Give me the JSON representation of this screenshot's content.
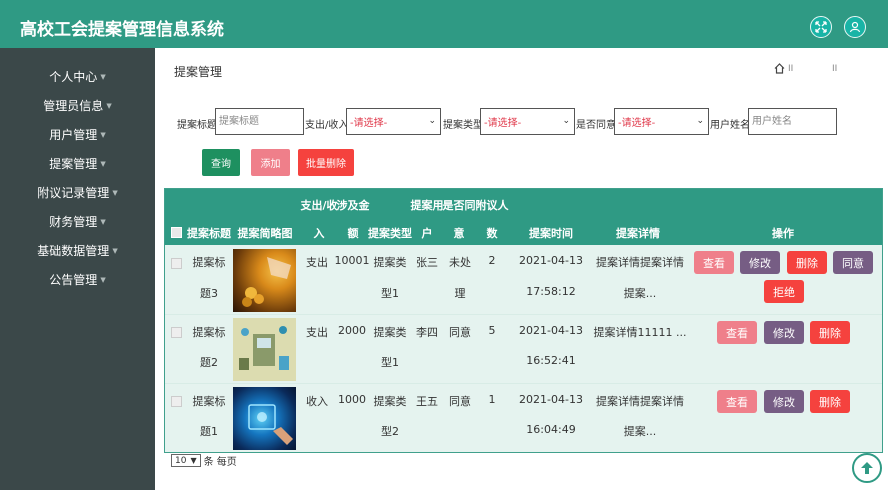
{
  "app": {
    "title": "高校工会提案管理信息系统"
  },
  "header_icons": [
    "fullscreen-icon",
    "user-icon"
  ],
  "sidebar": {
    "items": [
      {
        "label": "个人中心"
      },
      {
        "label": "管理员信息"
      },
      {
        "label": "用户管理"
      },
      {
        "label": "提案管理"
      },
      {
        "label": "附议记录管理"
      },
      {
        "label": "财务管理"
      },
      {
        "label": "基础数据管理"
      },
      {
        "label": "公告管理"
      }
    ]
  },
  "page": {
    "title": "提案管理",
    "crumb_sep": "II"
  },
  "filters": {
    "title_label": "提案标题",
    "title_placeholder": "提案标题",
    "income_label": "支出/收入",
    "income_value": "-请选择-",
    "type_label": "提案类型",
    "type_value": "-请选择-",
    "agree_label": "是否同意",
    "agree_value": "-请选择-",
    "user_label": "用户姓名",
    "user_placeholder": "用户姓名"
  },
  "buttons": {
    "query": "查询",
    "add": "添加",
    "batch_delete": "批量删除"
  },
  "table": {
    "headers": {
      "title": "提案标题",
      "image": "提案简略图",
      "income_top": "支出/收",
      "income_bottom": "入",
      "amount_top": "涉及金",
      "amount_bottom": "额",
      "type": "提案类型",
      "user_top": "提案用",
      "user_bottom": "户",
      "agree_top": "是否同",
      "agree_bottom": "意",
      "count_top": "附议人",
      "count_bottom": "数",
      "time": "提案时间",
      "detail": "提案详情",
      "action": "操作"
    },
    "rows": [
      {
        "title_l1": "提案标",
        "title_l2": "题3",
        "income": "支出",
        "amount": "10001",
        "type_l1": "提案类",
        "type_l2": "型1",
        "user": "张三",
        "agree_l1": "未处",
        "agree_l2": "理",
        "count": "2",
        "date": "2021-04-13",
        "time": "17:58:12",
        "detail_l1": "提案详情提案详情",
        "detail_l2": "提案...",
        "actions": [
          "查看",
          "修改",
          "删除",
          "同意",
          "拒绝"
        ],
        "image_icon": "gold-coins-image"
      },
      {
        "title_l1": "提案标",
        "title_l2": "题2",
        "income": "支出",
        "amount": "2000",
        "type_l1": "提案类",
        "type_l2": "型1",
        "user": "李四",
        "agree_l1": "同意",
        "agree_l2": "",
        "count": "5",
        "date": "2021-04-13",
        "time": "16:52:41",
        "detail_l1": "提案详情11111 ...",
        "detail_l2": "",
        "actions": [
          "查看",
          "修改",
          "删除"
        ],
        "image_icon": "finance-illustration-image"
      },
      {
        "title_l1": "提案标",
        "title_l2": "题1",
        "income": "收入",
        "amount": "1000",
        "type_l1": "提案类",
        "type_l2": "型2",
        "user": "王五",
        "agree_l1": "同意",
        "agree_l2": "",
        "count": "1",
        "date": "2021-04-13",
        "time": "16:04:49",
        "detail_l1": "提案详情提案详情",
        "detail_l2": "提案...",
        "actions": [
          "查看",
          "修改",
          "删除"
        ],
        "image_icon": "digital-tablet-image"
      }
    ]
  },
  "pager": {
    "page_size": "10",
    "suffix": "条 每页"
  }
}
